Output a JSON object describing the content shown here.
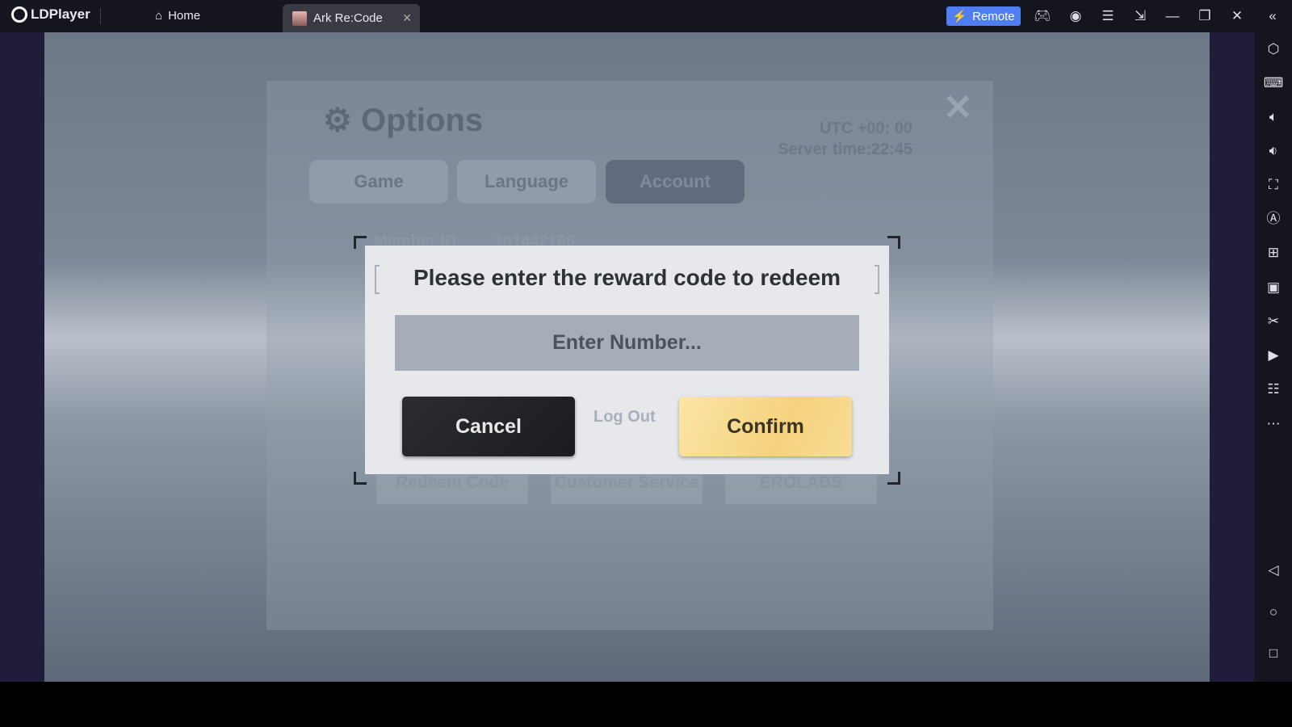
{
  "titlebar": {
    "app_name": "LDPlayer",
    "tabs": [
      {
        "label": "Home",
        "icon": "home-icon"
      },
      {
        "label": "Ark Re:Code",
        "icon": "game-thumbnail"
      }
    ],
    "remote_label": "Remote",
    "accent": "#4e7ef2"
  },
  "right_toolbar": [
    "settings-icon",
    "keyboard-icon",
    "volume-up-icon",
    "volume-down-icon",
    "screenshot-icon",
    "auto-icon",
    "add-window-icon",
    "apk-icon",
    "scissors-icon",
    "record-icon",
    "sync-icon",
    "more-icon",
    "back-icon",
    "home-circle-icon",
    "recents-icon"
  ],
  "background": {
    "title": "Options",
    "utc": "UTC +00: 00",
    "server_time": "Server time:22:45",
    "tabs": [
      "Game",
      "Language",
      "Account"
    ],
    "active_tab": "Account",
    "member_id_label": "Member ID:",
    "member_id": "101442166",
    "log_out": "Log Out",
    "buttons": [
      "Redeem Code",
      "Customer Service",
      "EROLABS"
    ]
  },
  "dialog": {
    "title": "Please enter the reward code to redeem",
    "input_placeholder": "Enter Number...",
    "input_value": "",
    "cancel_label": "Cancel",
    "confirm_label": "Confirm"
  }
}
